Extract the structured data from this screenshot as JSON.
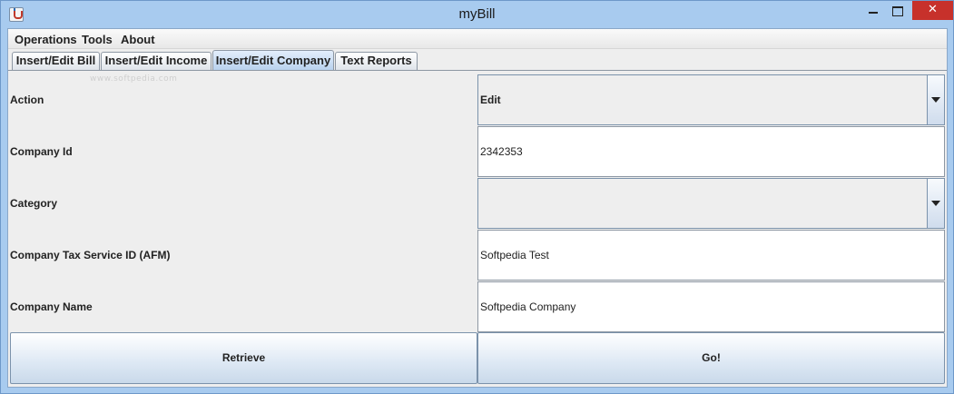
{
  "window": {
    "title": "myBill"
  },
  "menu": {
    "items": [
      "Operations",
      "Tools",
      "About"
    ]
  },
  "tabs": [
    {
      "label": "Insert/Edit Bill"
    },
    {
      "label": "Insert/Edit Income"
    },
    {
      "label": "Insert/Edit Company"
    },
    {
      "label": "Text Reports"
    }
  ],
  "active_tab": "Insert/Edit Company",
  "watermark": "www.softpedia.com",
  "form": {
    "action": {
      "label": "Action",
      "value": "Edit"
    },
    "company_id": {
      "label": "Company Id",
      "value": "2342353"
    },
    "category": {
      "label": "Category",
      "value": ""
    },
    "tax_service_id": {
      "label": "Company Tax Service ID (AFM)",
      "value": "Softpedia Test"
    },
    "company_name": {
      "label": "Company Name",
      "value": "Softpedia Company"
    }
  },
  "buttons": {
    "retrieve": "Retrieve",
    "go": "Go!"
  },
  "icons": {
    "app": "java-cup-icon",
    "minimize": "minimize-icon",
    "maximize": "maximize-icon",
    "close": "close-icon",
    "dropdown": "chevron-down-icon"
  },
  "colors": {
    "titlebar": "#a8cbef",
    "close_button": "#c7312b",
    "panel": "#eeeeee"
  }
}
